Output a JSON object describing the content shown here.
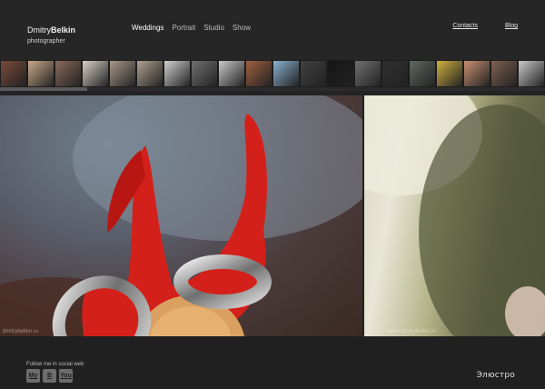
{
  "logo": {
    "first": "Dmitry",
    "last": "Belkin",
    "role": "photographer"
  },
  "nav": [
    {
      "label": "Weddings",
      "active": true
    },
    {
      "label": "Portrait"
    },
    {
      "label": "Studio"
    },
    {
      "label": "Show"
    }
  ],
  "top_links": {
    "contacts": "Contacts",
    "blog": "Blog"
  },
  "thumbnails": {
    "count": 20,
    "colors": [
      "#7a4a3a",
      "#c9a98a",
      "#8a6a5a",
      "#d8d0c8",
      "#a89888",
      "#b0a090",
      "#d0d0d0",
      "#707070",
      "#c8c8c8",
      "#a06040",
      "#8ab0d0",
      "#404040",
      "#151515",
      "#707070",
      "#303030",
      "#606860",
      "#d0b040",
      "#c89070",
      "#806050",
      "#c8c8c8"
    ]
  },
  "gallery": {
    "main_watermark": "dmitrybelkin.ru",
    "side_watermark": "www.dmitrybelkin.ru"
  },
  "footer": {
    "follow_text": "Follow me in social web",
    "social": [
      {
        "label": "My",
        "icon": "moi-mir-icon"
      },
      {
        "label": "B",
        "icon": "vkontakte-icon"
      },
      {
        "label": "You",
        "icon": "youtube-icon"
      }
    ],
    "brand": "Элюстро"
  }
}
